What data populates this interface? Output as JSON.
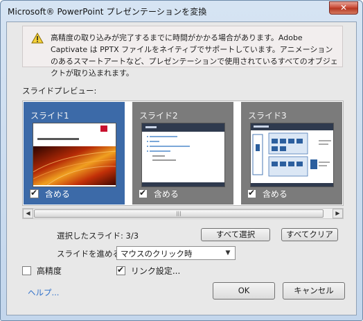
{
  "window": {
    "title": "Microsoft® PowerPoint プレゼンテーションを変換",
    "close_glyph": "✕"
  },
  "warning": {
    "icon": "warning-icon",
    "text": "高精度の取り込みが完了するまでに時間がかかる場合があります。Adobe Captivate は PPTX ファイルをネイティブでサポートしています。アニメーションのあるスマートアートなど、プレゼンテーションで使用されているすべてのオブジェクトが取り込まれます。"
  },
  "preview": {
    "label": "スライドプレビュー:",
    "slides": [
      {
        "name": "スライド1",
        "include_label": "含める",
        "checked": true,
        "selected": true
      },
      {
        "name": "スライド2",
        "include_label": "含める",
        "checked": true,
        "selected": false
      },
      {
        "name": "スライド3",
        "include_label": "含める",
        "checked": true,
        "selected": false
      }
    ],
    "scroll_grip": "|||"
  },
  "selection": {
    "label": "選択したスライド: 3/3",
    "select_all": "すべて選択",
    "clear_all": "すべてクリア"
  },
  "advance": {
    "label": "スライドを進める:",
    "value": "マウスのクリック時"
  },
  "options": {
    "high_fidelity": {
      "label": "高精度",
      "checked": false
    },
    "link": {
      "label": "リンク設定...",
      "checked": true
    }
  },
  "footer": {
    "help": "ヘルプ...",
    "ok": "OK",
    "cancel": "キャンセル"
  },
  "colors": {
    "selected_slide": "#3c6aa8",
    "unselected_slide": "#7b7b7b",
    "help_link": "#2d6fc9"
  }
}
